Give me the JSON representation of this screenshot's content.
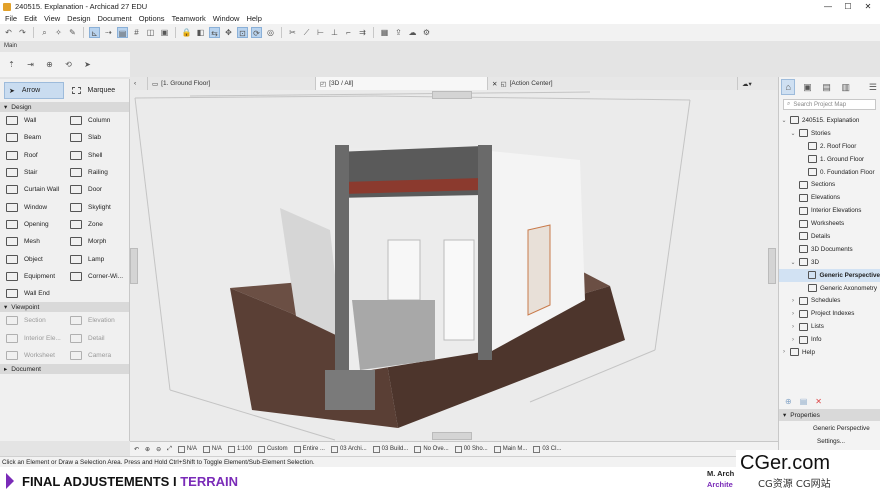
{
  "window": {
    "title": "240515. Explanation - Archicad 27 EDU",
    "minimize": "—",
    "maximize": "☐",
    "close": "✕"
  },
  "menu": [
    "File",
    "Edit",
    "View",
    "Design",
    "Document",
    "Options",
    "Teamwork",
    "Window",
    "Help"
  ],
  "toolbar_label": "Main",
  "toolbox": {
    "arrow": "Arrow",
    "marquee": "Marquee",
    "design_header": "Design",
    "design_tools": [
      "Wall",
      "Column",
      "Beam",
      "Slab",
      "Roof",
      "Shell",
      "Stair",
      "Railing",
      "Curtain Wall",
      "Door",
      "Window",
      "Skylight",
      "Opening",
      "Zone",
      "Mesh",
      "Morph",
      "Object",
      "Lamp",
      "Equipment",
      "Corner-Wi...",
      "Wall End"
    ],
    "viewpoint_header": "Viewpoint",
    "viewpoint_tools": [
      "Section",
      "Elevation",
      "Interior Ele...",
      "Detail",
      "Worksheet",
      "Camera"
    ],
    "document_header": "Document"
  },
  "tabs": [
    {
      "label": "[1. Ground Floor]"
    },
    {
      "label": "[3D / All]"
    },
    {
      "label": "[Action Center]"
    }
  ],
  "statusbar": {
    "na1": "N/A",
    "na2": "N/A",
    "scale": "1:100",
    "custom": "Custom",
    "entire": "Entire ...",
    "archi": "03 Archi...",
    "build": "03 Build...",
    "nooverride": "No Ove...",
    "show": "00 Sho...",
    "mainmodel": "Main M...",
    "last": "03 Cl..."
  },
  "navigator": {
    "search_placeholder": "Search Project Map",
    "tree": [
      {
        "label": "240515. Explanation",
        "depth": 0,
        "toggle": "⌄"
      },
      {
        "label": "Stories",
        "depth": 1,
        "toggle": "⌄"
      },
      {
        "label": "2. Roof Floor",
        "depth": 2,
        "toggle": ""
      },
      {
        "label": "1. Ground Floor",
        "depth": 2,
        "toggle": ""
      },
      {
        "label": "0. Foundation Floor",
        "depth": 2,
        "toggle": ""
      },
      {
        "label": "Sections",
        "depth": 1,
        "toggle": ""
      },
      {
        "label": "Elevations",
        "depth": 1,
        "toggle": ""
      },
      {
        "label": "Interior Elevations",
        "depth": 1,
        "toggle": ""
      },
      {
        "label": "Worksheets",
        "depth": 1,
        "toggle": ""
      },
      {
        "label": "Details",
        "depth": 1,
        "toggle": ""
      },
      {
        "label": "3D Documents",
        "depth": 1,
        "toggle": ""
      },
      {
        "label": "3D",
        "depth": 1,
        "toggle": "⌄"
      },
      {
        "label": "Generic Perspective",
        "depth": 2,
        "toggle": "",
        "selected": true
      },
      {
        "label": "Generic Axonometry",
        "depth": 2,
        "toggle": ""
      },
      {
        "label": "Schedules",
        "depth": 1,
        "toggle": "›"
      },
      {
        "label": "Project Indexes",
        "depth": 1,
        "toggle": "›"
      },
      {
        "label": "Lists",
        "depth": 1,
        "toggle": "›"
      },
      {
        "label": "Info",
        "depth": 1,
        "toggle": "›"
      },
      {
        "label": "Help",
        "depth": 0,
        "toggle": "›"
      }
    ],
    "properties_header": "Properties",
    "properties_value": "Generic Perspective",
    "settings": "Settings..."
  },
  "hint": "Click an Element or Draw a Selection Area. Press and Hold Ctrl+Shift to Toggle Element/Sub-Element Selection.",
  "caption": {
    "part1": "FINAL ADJUSTEMENTS I",
    "part2": "TERRAIN",
    "color1": "#111111",
    "color2": "#7a2bb8"
  },
  "corner": {
    "name": "M. Arch",
    "role": "Archite"
  },
  "watermark": {
    "big": "CGer.com",
    "small": "CG资源  CG网站"
  }
}
